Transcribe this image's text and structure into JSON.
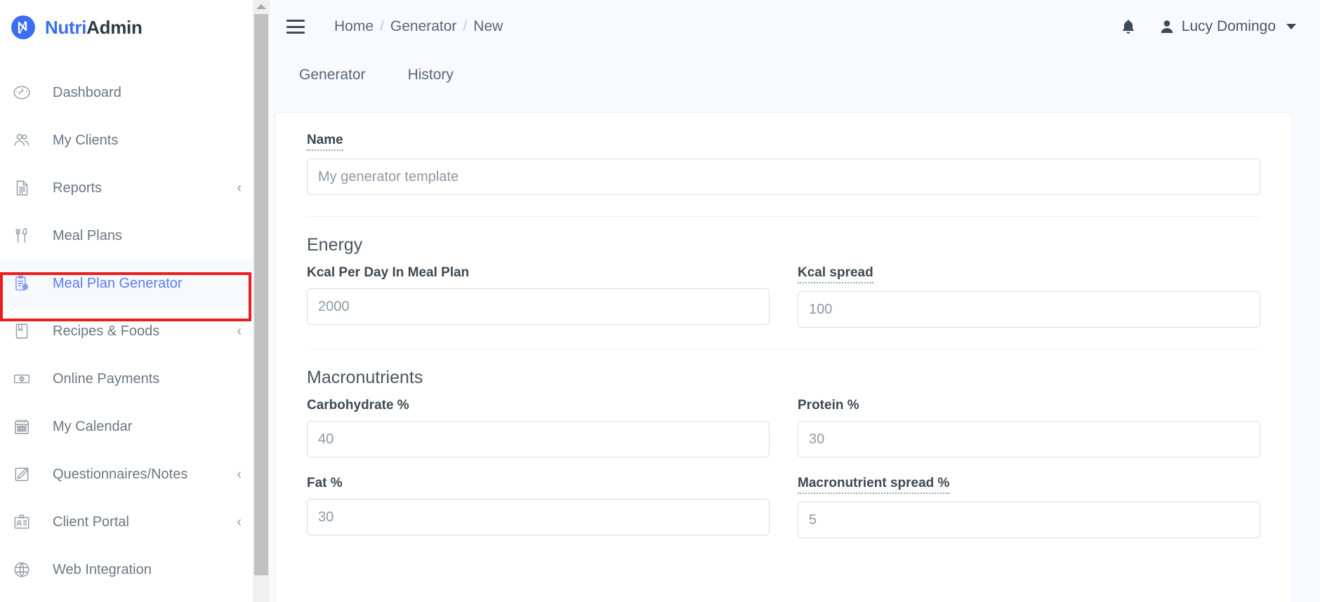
{
  "brand": {
    "name_first": "Nutri",
    "name_second": "Admin",
    "logo_icon": "nutriadmin-logo-icon"
  },
  "sidebar": {
    "items": [
      {
        "label": "Dashboard",
        "icon": "gauge-icon",
        "chevron": "",
        "active": false
      },
      {
        "label": "My Clients",
        "icon": "users-icon",
        "chevron": "",
        "active": false
      },
      {
        "label": "Reports",
        "icon": "document-icon",
        "chevron": "‹",
        "active": false
      },
      {
        "label": "Meal Plans",
        "icon": "cutlery-icon",
        "chevron": "",
        "active": false
      },
      {
        "label": "Meal Plan Generator",
        "icon": "clipboard-apple-icon",
        "chevron": "",
        "active": true
      },
      {
        "label": "Recipes & Foods",
        "icon": "recipe-book-icon",
        "chevron": "‹",
        "active": false
      },
      {
        "label": "Online Payments",
        "icon": "banknote-icon",
        "chevron": "",
        "active": false
      },
      {
        "label": "My Calendar",
        "icon": "calendar-icon",
        "chevron": "",
        "active": false
      },
      {
        "label": "Questionnaires/Notes",
        "icon": "pencil-square-icon",
        "chevron": "‹",
        "active": false
      },
      {
        "label": "Client Portal",
        "icon": "id-card-icon",
        "chevron": "‹",
        "active": false
      },
      {
        "label": "Web Integration",
        "icon": "globe-icon",
        "chevron": "",
        "active": false
      }
    ],
    "highlight_color": "#ee1c1c",
    "active_color": "#5b7cfa"
  },
  "topbar": {
    "menu_icon": "hamburger-icon",
    "breadcrumb": [
      "Home",
      "Generator",
      "New"
    ],
    "breadcrumb_separator": "/",
    "notification_icon": "bell-icon",
    "user_icon": "user-icon",
    "user_name": "Lucy Domingo",
    "caret_icon": "chevron-down-icon"
  },
  "tabs": [
    {
      "label": "Generator",
      "active": true
    },
    {
      "label": "History",
      "active": false
    }
  ],
  "form": {
    "name": {
      "label": "Name",
      "tooltip_underline": true,
      "value": "",
      "placeholder": "My generator template"
    },
    "energy": {
      "section_title": "Energy",
      "kcal_per_day": {
        "label": "Kcal Per Day In Meal Plan",
        "tooltip_underline": false,
        "value": "",
        "placeholder": "2000"
      },
      "kcal_spread": {
        "label": "Kcal spread",
        "tooltip_underline": true,
        "value": "",
        "placeholder": "100"
      }
    },
    "macronutrients": {
      "section_title": "Macronutrients",
      "carbohydrate": {
        "label": "Carbohydrate %",
        "tooltip_underline": false,
        "value": "",
        "placeholder": "40"
      },
      "protein": {
        "label": "Protein %",
        "tooltip_underline": false,
        "value": "",
        "placeholder": "30"
      },
      "fat": {
        "label": "Fat %",
        "tooltip_underline": false,
        "value": "",
        "placeholder": "30"
      },
      "macro_spread": {
        "label": "Macronutrient spread %",
        "tooltip_underline": true,
        "value": "",
        "placeholder": "5"
      }
    }
  }
}
